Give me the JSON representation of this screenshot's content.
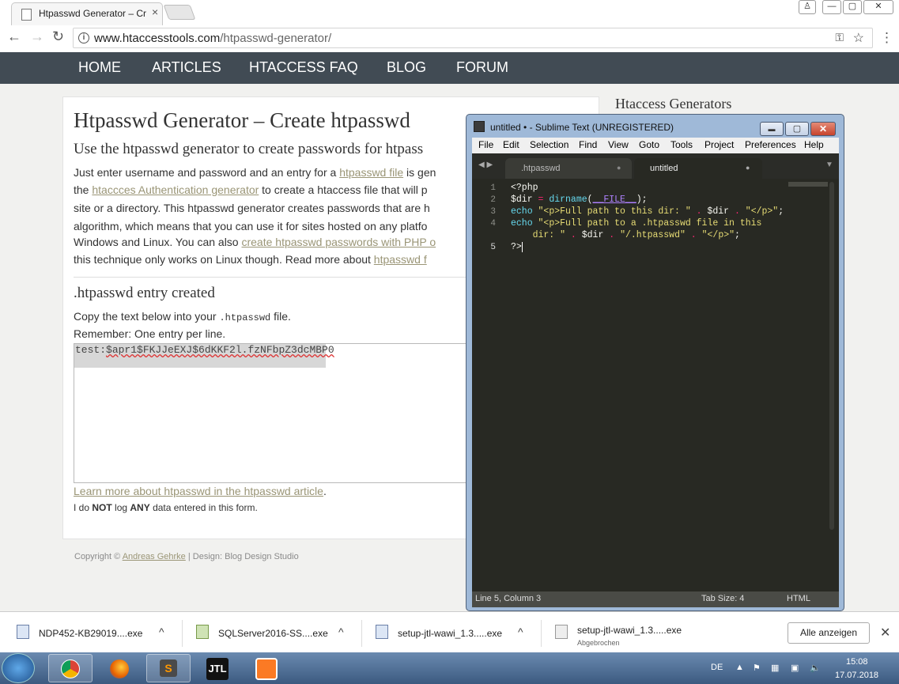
{
  "browser": {
    "tab_title": "Htpasswd Generator – Cr",
    "tab_close": "×",
    "url_domain": "www.htaccesstools.com",
    "url_path": "/htpasswd-generator/",
    "win_user": "♙",
    "win_min": "—",
    "win_max": "▢",
    "win_close": "✕"
  },
  "site": {
    "nav": [
      "HOME",
      "ARTICLES",
      "HTACCESS FAQ",
      "BLOG",
      "FORUM"
    ],
    "title": "Htpasswd Generator – Create htpasswd",
    "subtitle": "Use the htpasswd generator to create passwords for htpass",
    "p1a": "Just enter username and password and an entry for a ",
    "p1link": "htpasswd file",
    "p1b": " is gen",
    "p2a": "the ",
    "p2link": "htaccces Authentication generator",
    "p2b": " to create a htaccess file that will p",
    "p3": "site or a directory. This htpasswd generator creates passwords that are h",
    "p4": "algorithm, which means that you can use it for sites hosted on any platfo",
    "p5a": "Windows and Linux. You can also ",
    "p5link": "create htpasswd passwords with PHP o",
    "p6a": "this technique only works on Linux though. Read more about ",
    "p6link": "htpasswd f",
    "section_title": ".htpasswd entry created",
    "copy_a": "Copy the text below into your ",
    "copy_code": ".htpasswd",
    "copy_b": " file.",
    "remember": "Remember: One entry per line.",
    "entry_user": "test:",
    "entry_hash": "$apr1$FKJJeEXJ$6dKKF2l.fzNFbpZ3dcMBP0",
    "learn_link": "Learn more about htpasswd in the htpasswd article",
    "learn_dot": ".",
    "nolog_a": "I do ",
    "nolog_not": "NOT",
    "nolog_b": " log ",
    "nolog_any": "ANY",
    "nolog_c": " data entered in this form.",
    "copyright_a": "Copyright © ",
    "copyright_link": "Andreas Gehrke",
    "copyright_b": " | Design: Blog Design Studio",
    "sidebar_heading": "Htaccess Generators"
  },
  "sublime": {
    "title": "untitled • - Sublime Text (UNREGISTERED)",
    "menu": [
      "File",
      "Edit",
      "Selection",
      "Find",
      "View",
      "Goto",
      "Tools",
      "Project",
      "Preferences",
      "Help"
    ],
    "tabs": [
      ".htpasswd",
      "untitled"
    ],
    "tab_dot": "●",
    "arrows": "◀ ▶",
    "dropdown": "▼",
    "line_numbers": [
      "1",
      "2",
      "3",
      "4",
      "",
      "5"
    ],
    "code": {
      "l1": "<?php",
      "l2_var": "$dir",
      "l2_eq": " = ",
      "l2_fn": "dirname",
      "l2_open": "(",
      "l2_const": "__FILE__",
      "l2_close": ");",
      "l3_kw": "echo",
      "l3_s1": " \"<p>Full path to this dir: \"",
      "l3_dot1": " . ",
      "l3_var": "$dir",
      "l3_dot2": " . ",
      "l3_s2": "\"</p>\"",
      "l3_end": ";",
      "l4_kw": "echo",
      "l4_s1": " \"<p>Full path to a .htpasswd file in this",
      "l4b_s1": "    dir: \"",
      "l4b_dot1": " . ",
      "l4b_var": "$dir",
      "l4b_dot2": " . ",
      "l4b_s2": "\"/.htpasswd\"",
      "l4b_dot3": " . ",
      "l4b_s3": "\"</p>\"",
      "l4b_end": ";",
      "l5": "?>"
    },
    "status_pos": "Line 5, Column 3",
    "status_tab": "Tab Size: 4",
    "status_syntax": "HTML",
    "btn_min": "▬",
    "btn_max": "▢",
    "btn_close": "✕"
  },
  "downloads": {
    "items": [
      {
        "name": "NDP452-KB29019....exe",
        "sub": ""
      },
      {
        "name": "SQLServer2016-SS....exe",
        "sub": ""
      },
      {
        "name": "setup-jtl-wawi_1.3.....exe",
        "sub": ""
      },
      {
        "name": "setup-jtl-wawi_1.3.....exe",
        "sub": "Abgebrochen"
      }
    ],
    "chevron": "^",
    "show_all": "Alle anzeigen",
    "close": "✕"
  },
  "taskbar": {
    "lang": "DE",
    "time": "15:08",
    "date": "17.07.2018",
    "jtl": "JTL",
    "sublime_letter": "S"
  },
  "colors": {
    "nav_bg": "#414b54",
    "link": "#9a9576",
    "editor_bg": "#282923",
    "taskbar": "#4a6a92"
  }
}
